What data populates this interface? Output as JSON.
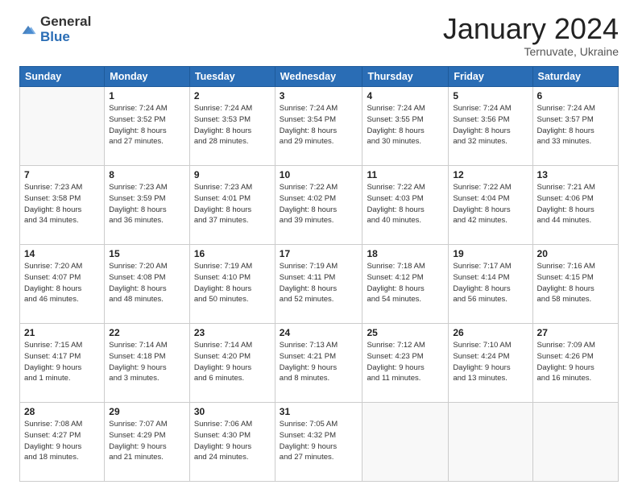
{
  "logo": {
    "general": "General",
    "blue": "Blue"
  },
  "header": {
    "title": "January 2024",
    "subtitle": "Ternuvate, Ukraine"
  },
  "weekdays": [
    "Sunday",
    "Monday",
    "Tuesday",
    "Wednesday",
    "Thursday",
    "Friday",
    "Saturday"
  ],
  "weeks": [
    [
      {
        "day": "",
        "info": ""
      },
      {
        "day": "1",
        "info": "Sunrise: 7:24 AM\nSunset: 3:52 PM\nDaylight: 8 hours\nand 27 minutes."
      },
      {
        "day": "2",
        "info": "Sunrise: 7:24 AM\nSunset: 3:53 PM\nDaylight: 8 hours\nand 28 minutes."
      },
      {
        "day": "3",
        "info": "Sunrise: 7:24 AM\nSunset: 3:54 PM\nDaylight: 8 hours\nand 29 minutes."
      },
      {
        "day": "4",
        "info": "Sunrise: 7:24 AM\nSunset: 3:55 PM\nDaylight: 8 hours\nand 30 minutes."
      },
      {
        "day": "5",
        "info": "Sunrise: 7:24 AM\nSunset: 3:56 PM\nDaylight: 8 hours\nand 32 minutes."
      },
      {
        "day": "6",
        "info": "Sunrise: 7:24 AM\nSunset: 3:57 PM\nDaylight: 8 hours\nand 33 minutes."
      }
    ],
    [
      {
        "day": "7",
        "info": "Sunrise: 7:23 AM\nSunset: 3:58 PM\nDaylight: 8 hours\nand 34 minutes."
      },
      {
        "day": "8",
        "info": "Sunrise: 7:23 AM\nSunset: 3:59 PM\nDaylight: 8 hours\nand 36 minutes."
      },
      {
        "day": "9",
        "info": "Sunrise: 7:23 AM\nSunset: 4:01 PM\nDaylight: 8 hours\nand 37 minutes."
      },
      {
        "day": "10",
        "info": "Sunrise: 7:22 AM\nSunset: 4:02 PM\nDaylight: 8 hours\nand 39 minutes."
      },
      {
        "day": "11",
        "info": "Sunrise: 7:22 AM\nSunset: 4:03 PM\nDaylight: 8 hours\nand 40 minutes."
      },
      {
        "day": "12",
        "info": "Sunrise: 7:22 AM\nSunset: 4:04 PM\nDaylight: 8 hours\nand 42 minutes."
      },
      {
        "day": "13",
        "info": "Sunrise: 7:21 AM\nSunset: 4:06 PM\nDaylight: 8 hours\nand 44 minutes."
      }
    ],
    [
      {
        "day": "14",
        "info": "Sunrise: 7:20 AM\nSunset: 4:07 PM\nDaylight: 8 hours\nand 46 minutes."
      },
      {
        "day": "15",
        "info": "Sunrise: 7:20 AM\nSunset: 4:08 PM\nDaylight: 8 hours\nand 48 minutes."
      },
      {
        "day": "16",
        "info": "Sunrise: 7:19 AM\nSunset: 4:10 PM\nDaylight: 8 hours\nand 50 minutes."
      },
      {
        "day": "17",
        "info": "Sunrise: 7:19 AM\nSunset: 4:11 PM\nDaylight: 8 hours\nand 52 minutes."
      },
      {
        "day": "18",
        "info": "Sunrise: 7:18 AM\nSunset: 4:12 PM\nDaylight: 8 hours\nand 54 minutes."
      },
      {
        "day": "19",
        "info": "Sunrise: 7:17 AM\nSunset: 4:14 PM\nDaylight: 8 hours\nand 56 minutes."
      },
      {
        "day": "20",
        "info": "Sunrise: 7:16 AM\nSunset: 4:15 PM\nDaylight: 8 hours\nand 58 minutes."
      }
    ],
    [
      {
        "day": "21",
        "info": "Sunrise: 7:15 AM\nSunset: 4:17 PM\nDaylight: 9 hours\nand 1 minute."
      },
      {
        "day": "22",
        "info": "Sunrise: 7:14 AM\nSunset: 4:18 PM\nDaylight: 9 hours\nand 3 minutes."
      },
      {
        "day": "23",
        "info": "Sunrise: 7:14 AM\nSunset: 4:20 PM\nDaylight: 9 hours\nand 6 minutes."
      },
      {
        "day": "24",
        "info": "Sunrise: 7:13 AM\nSunset: 4:21 PM\nDaylight: 9 hours\nand 8 minutes."
      },
      {
        "day": "25",
        "info": "Sunrise: 7:12 AM\nSunset: 4:23 PM\nDaylight: 9 hours\nand 11 minutes."
      },
      {
        "day": "26",
        "info": "Sunrise: 7:10 AM\nSunset: 4:24 PM\nDaylight: 9 hours\nand 13 minutes."
      },
      {
        "day": "27",
        "info": "Sunrise: 7:09 AM\nSunset: 4:26 PM\nDaylight: 9 hours\nand 16 minutes."
      }
    ],
    [
      {
        "day": "28",
        "info": "Sunrise: 7:08 AM\nSunset: 4:27 PM\nDaylight: 9 hours\nand 18 minutes."
      },
      {
        "day": "29",
        "info": "Sunrise: 7:07 AM\nSunset: 4:29 PM\nDaylight: 9 hours\nand 21 minutes."
      },
      {
        "day": "30",
        "info": "Sunrise: 7:06 AM\nSunset: 4:30 PM\nDaylight: 9 hours\nand 24 minutes."
      },
      {
        "day": "31",
        "info": "Sunrise: 7:05 AM\nSunset: 4:32 PM\nDaylight: 9 hours\nand 27 minutes."
      },
      {
        "day": "",
        "info": ""
      },
      {
        "day": "",
        "info": ""
      },
      {
        "day": "",
        "info": ""
      }
    ]
  ]
}
